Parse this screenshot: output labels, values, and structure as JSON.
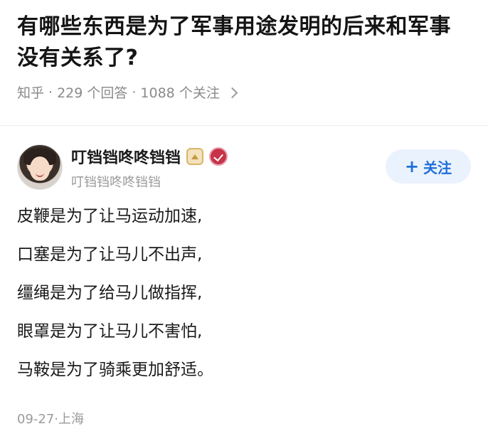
{
  "question": {
    "title": "有哪些东西是为了军事用途发明的后来和军事没有关系了?",
    "source": "知乎",
    "answers_count": "229 个回答",
    "follows_count": "1088 个关注",
    "separator": "·"
  },
  "answer": {
    "author": {
      "name": "叮铛铛咚咚铛铛",
      "subtitle": "叮铛铛咚咚铛铛",
      "badges": [
        "crown-icon",
        "verified-icon"
      ],
      "avatar_icon": "avatar-photo"
    },
    "follow_button": {
      "label": "关注",
      "icon": "+"
    },
    "lines": [
      "皮鞭是为了让马运动加速,",
      "口塞是为了让马儿不出声,",
      "缰绳是为了给马儿做指挥,",
      "眼罩是为了让马儿不害怕,",
      "马鞍是为了骑乘更加舒适。"
    ],
    "footer": "09-27·上海"
  },
  "colors": {
    "accent": "#1f6fd8",
    "follow_bg": "#eaf2fd",
    "meta_text": "#8a8a8a",
    "verify_badge": "#c8334a",
    "crown_badge": "#d9b56a"
  }
}
